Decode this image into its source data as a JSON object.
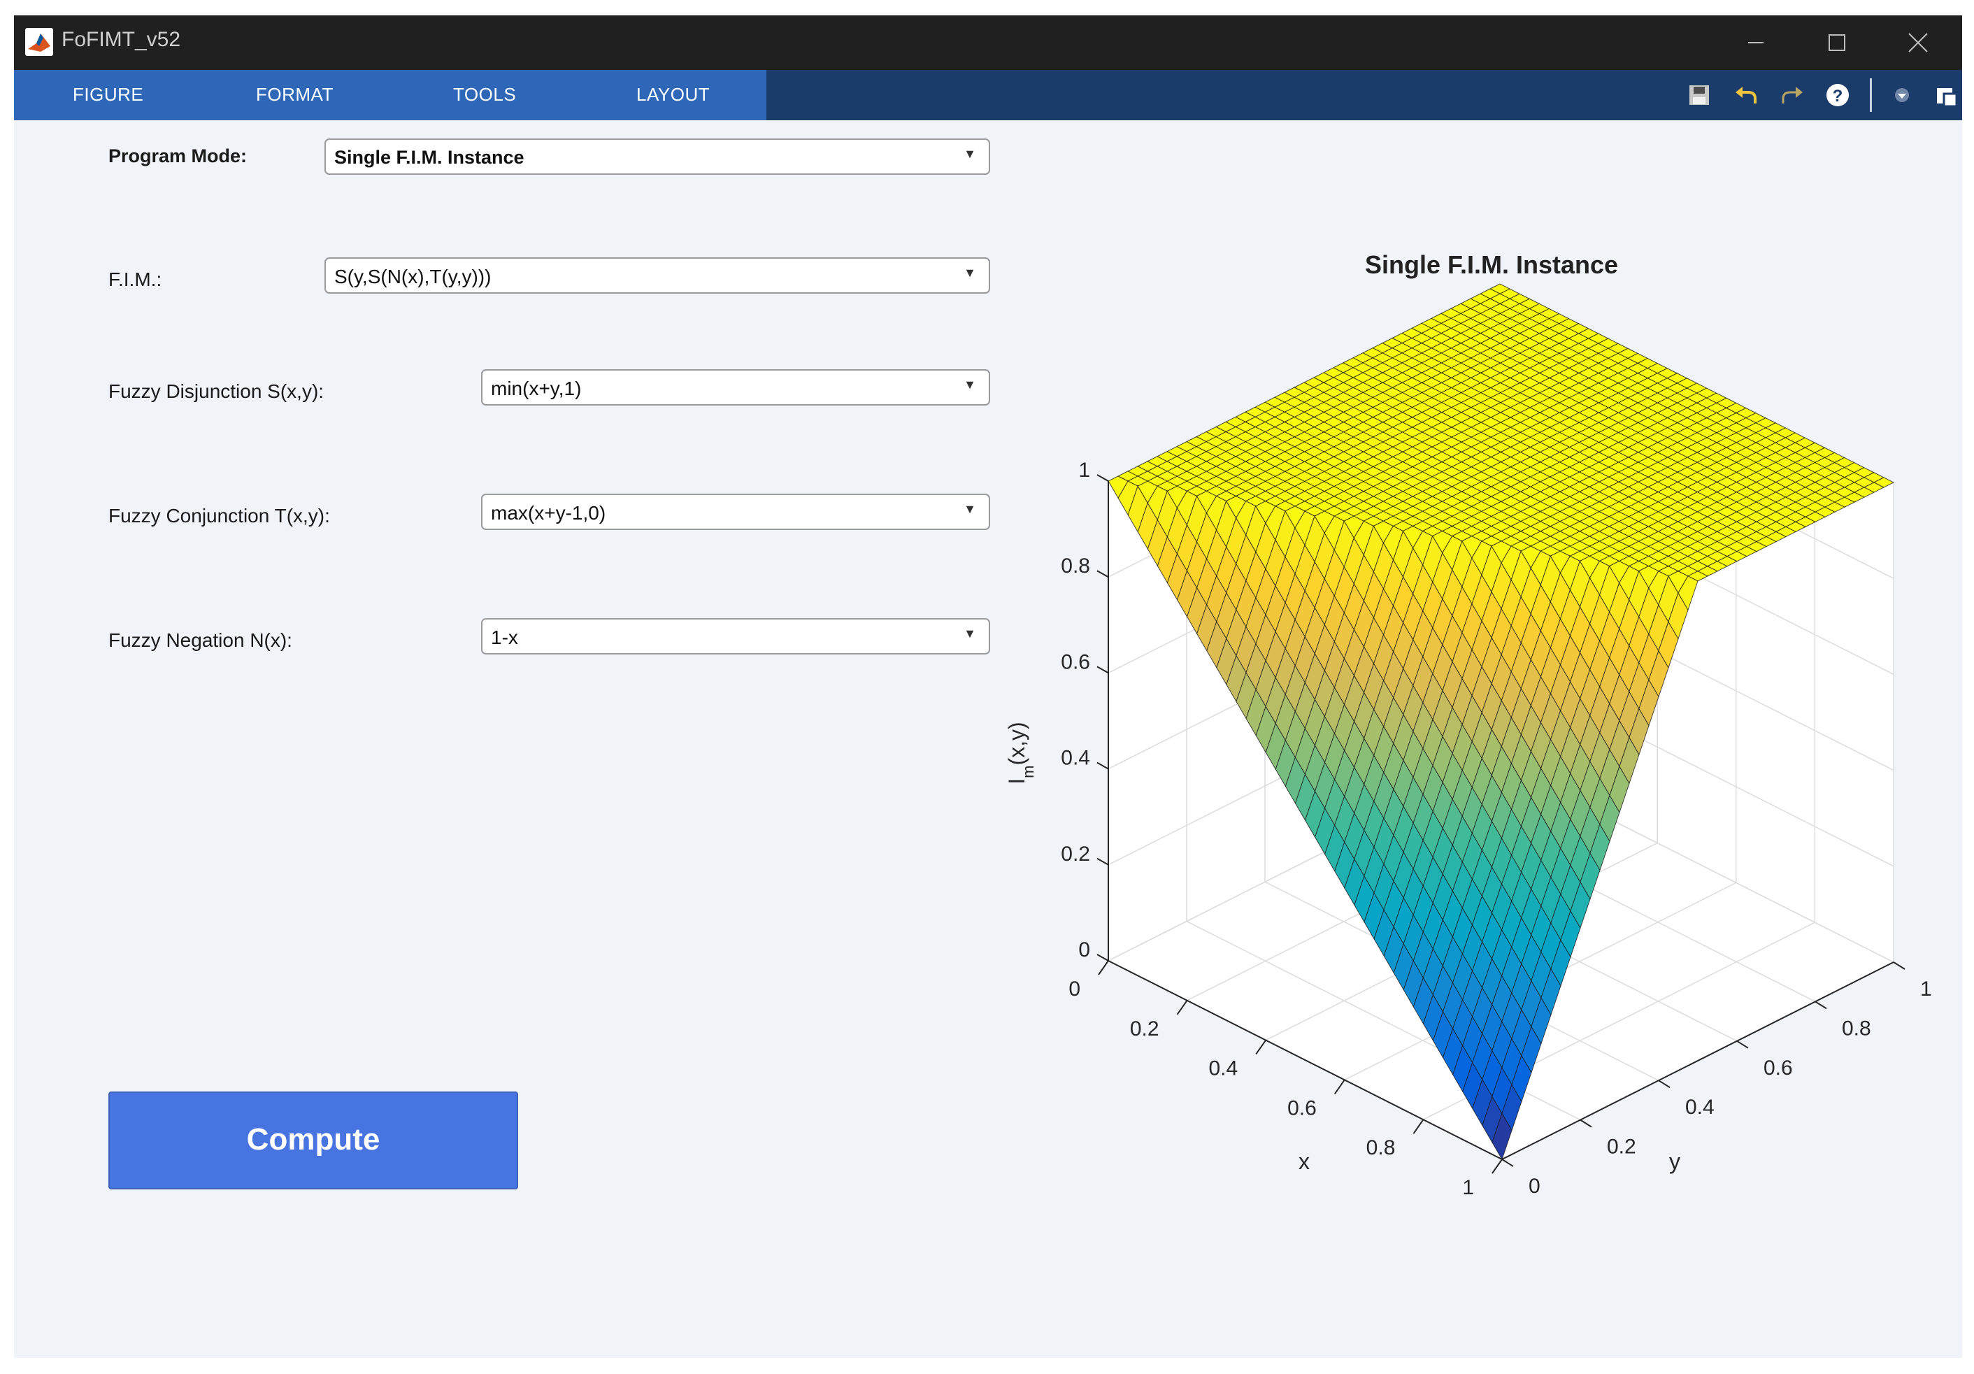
{
  "window": {
    "title": "FoFIMT_v52"
  },
  "menu": {
    "tabs": [
      "FIGURE",
      "FORMAT",
      "TOOLS",
      "LAYOUT"
    ]
  },
  "form": {
    "program_mode": {
      "label": "Program Mode:",
      "value": "Single F.I.M. Instance"
    },
    "fim": {
      "label": "F.I.M.:",
      "value": "S(y,S(N(x),T(y,y)))"
    },
    "disjunction": {
      "label": "Fuzzy Disjunction S(x,y):",
      "value": "min(x+y,1)"
    },
    "conjunction": {
      "label": "Fuzzy Conjunction T(x,y):",
      "value": "max(x+y-1,0)"
    },
    "negation": {
      "label": "Fuzzy Negation N(x):",
      "value": "1-x"
    }
  },
  "compute": {
    "label": "Compute"
  },
  "colors": {
    "menu_active": "#2f67b8",
    "menu_bar": "#1b3b6a",
    "compute_button": "#4874e2",
    "background": "#f0f4f9"
  },
  "icons": [
    "matlab-icon",
    "minimize-icon",
    "maximize-icon",
    "close-icon",
    "save-icon",
    "undo-icon",
    "redo-icon",
    "help-icon",
    "dropdown-icon",
    "undock-icon"
  ],
  "chart_data": {
    "type": "surface",
    "title": "Single F.I.M. Instance",
    "xlabel": "x",
    "ylabel": "y",
    "zlabel_main": "I",
    "zlabel_sub": "m",
    "zlabel_rest": "(x,y)",
    "xlim": [
      0,
      1
    ],
    "ylim": [
      0,
      1
    ],
    "zlim": [
      0,
      1
    ],
    "xticks": [
      "0",
      "0.2",
      "0.4",
      "0.6",
      "0.8",
      "1"
    ],
    "yticks": [
      "0",
      "0.2",
      "0.4",
      "0.6",
      "0.8",
      "1"
    ],
    "zticks": [
      "0",
      "0.2",
      "0.4",
      "0.6",
      "0.8",
      "1"
    ],
    "function": "I(x,y) = min(1 - x + 2y, 1)",
    "grid": true,
    "colormap": "parula",
    "mesh_divisions": 40
  }
}
